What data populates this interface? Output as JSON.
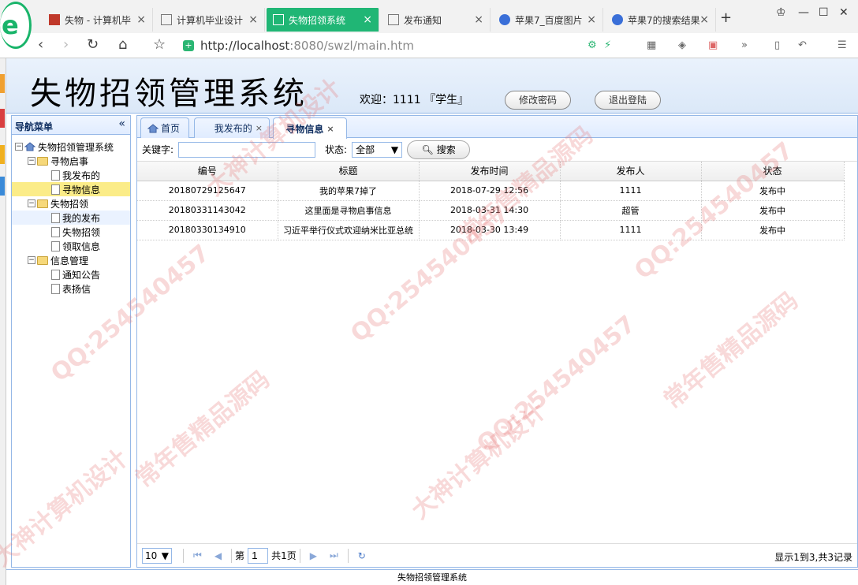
{
  "browser": {
    "tabs": [
      {
        "label": "失物 - 计算机毕",
        "active": false
      },
      {
        "label": "计算机毕业设计",
        "active": false
      },
      {
        "label": "失物招领系统",
        "active": true
      },
      {
        "label": "发布通知",
        "active": false
      },
      {
        "label": "苹果7_百度图片",
        "active": false
      },
      {
        "label": "苹果7的搜索结果",
        "active": false
      }
    ],
    "url_host": "http://localhost",
    "url_rest": ":8080/swzl/main.htm",
    "new_tab_glyph": "+",
    "close_glyph": "×"
  },
  "header": {
    "title": "失物招领管理系统",
    "welcome": "欢迎：1111 『学生』",
    "change_password": "修改密码",
    "logout": "退出登陆"
  },
  "nav": {
    "title": "导航菜单",
    "collapse_glyph": "«",
    "root": "失物招领管理系统",
    "groups": [
      {
        "label": "寻物启事",
        "items": [
          "我发布的",
          "寻物信息"
        ]
      },
      {
        "label": "失物招领",
        "items": [
          "我的发布",
          "失物招领",
          "领取信息"
        ]
      },
      {
        "label": "信息管理",
        "items": [
          "通知公告",
          "表扬信"
        ]
      }
    ]
  },
  "tabs": [
    {
      "label": "首页"
    },
    {
      "label": "我发布的"
    },
    {
      "label": "寻物信息"
    }
  ],
  "search": {
    "keyword_label": "关键字:",
    "keyword_value": "",
    "status_label": "状态:",
    "status_value": "全部",
    "search_button": "搜索"
  },
  "table": {
    "columns": [
      "编号",
      "标题",
      "发布时间",
      "发布人",
      "状态"
    ],
    "rows": [
      [
        "20180729125647",
        "我的苹果7掉了",
        "2018-07-29 12:56",
        "1111",
        "发布中"
      ],
      [
        "20180331143042",
        "这里面是寻物启事信息",
        "2018-03-31 14:30",
        "超管",
        "发布中"
      ],
      [
        "20180330134910",
        "习近平举行仪式欢迎纳米比亚总统",
        "2018-03-30 13:49",
        "1111",
        "发布中"
      ]
    ]
  },
  "pager": {
    "page_size": "10",
    "page_prefix": "第",
    "page_value": "1",
    "page_total": "共1页",
    "info": "显示1到3,共3记录"
  },
  "footer": "失物招领管理系统",
  "watermarks": [
    "QQ:254540457",
    "常年售精品源码",
    "大神计算机设计"
  ],
  "colors": {
    "accent": "#20b675",
    "panel_border": "#95b8e7",
    "selected_node": "#fbec88"
  }
}
